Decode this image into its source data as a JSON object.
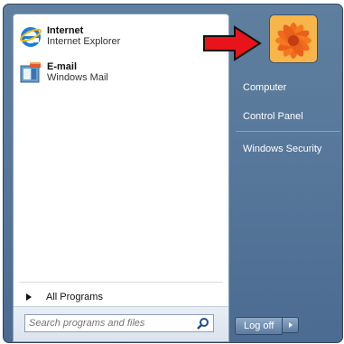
{
  "pinned": [
    {
      "title": "Internet",
      "subtitle": "Internet Explorer",
      "icon": "internet-explorer-icon"
    },
    {
      "title": "E-mail",
      "subtitle": "Windows Mail",
      "icon": "windows-mail-icon"
    }
  ],
  "all_programs": "All Programs",
  "search": {
    "placeholder": "Search programs and files",
    "value": ""
  },
  "right_items": [
    "Computer",
    "Control Panel",
    "Windows Security"
  ],
  "log_off": "Log off",
  "colors": {
    "accent_arrow": "#e8141a",
    "menu_blue": "#56779a"
  }
}
